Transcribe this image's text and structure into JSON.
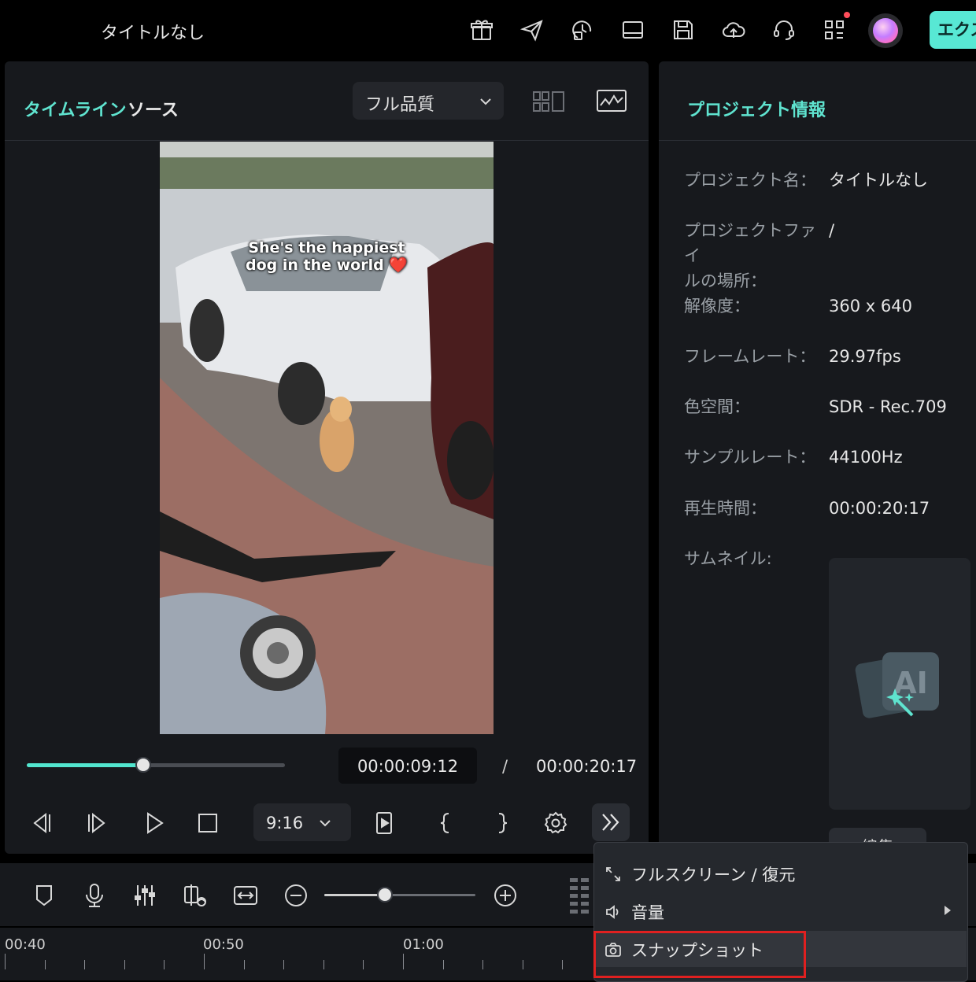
{
  "app": {
    "title": "タイトルなし",
    "export_label": "エクスポート"
  },
  "topbar_icons": [
    "gift-icon",
    "send-icon",
    "history-icon",
    "layout-icon",
    "save-icon",
    "cloud-icon",
    "support-icon",
    "apps-icon"
  ],
  "player": {
    "tabs": [
      "タイムライン",
      "ソース"
    ],
    "quality": "フル品質",
    "caption_line1": "She's the happiest",
    "caption_line2": "dog in the world ❤️",
    "current_time": "00:00:09:12",
    "separator": "/",
    "total_time": "00:00:20:17",
    "progress": 0.45,
    "aspect_ratio": "9:16"
  },
  "project_info": {
    "title": "プロジェクト情報",
    "rows": [
      {
        "label": "プロジェクト名：",
        "value": "タイトルなし"
      },
      {
        "label": "プロジェクトファイ\nルの場所：",
        "value": "/"
      },
      {
        "label": "解像度：",
        "value": "360 x 640"
      },
      {
        "label": "フレームレート：",
        "value": "29.97fps"
      },
      {
        "label": "色空間：",
        "value": "SDR - Rec.709"
      },
      {
        "label": "サンプルレート：",
        "value": "44100Hz"
      },
      {
        "label": "再生時間：",
        "value": "00:00:20:17"
      },
      {
        "label": "サムネイル:",
        "value": ""
      }
    ],
    "edit_label": "編集"
  },
  "timeline": {
    "zoom_level": 0.4,
    "ruler_labels": [
      "00:40",
      "00:50",
      "01:00"
    ]
  },
  "context_menu": {
    "items": [
      {
        "label": "フルスクリーン / 復元",
        "icon": "fullscreen-icon"
      },
      {
        "label": "音量",
        "icon": "volume-icon"
      },
      {
        "label": "スナップショット",
        "icon": "camera-icon"
      }
    ]
  },
  "colors": {
    "accent": "#52e6cf",
    "highlight": "#e02020",
    "panel": "#17191d"
  }
}
